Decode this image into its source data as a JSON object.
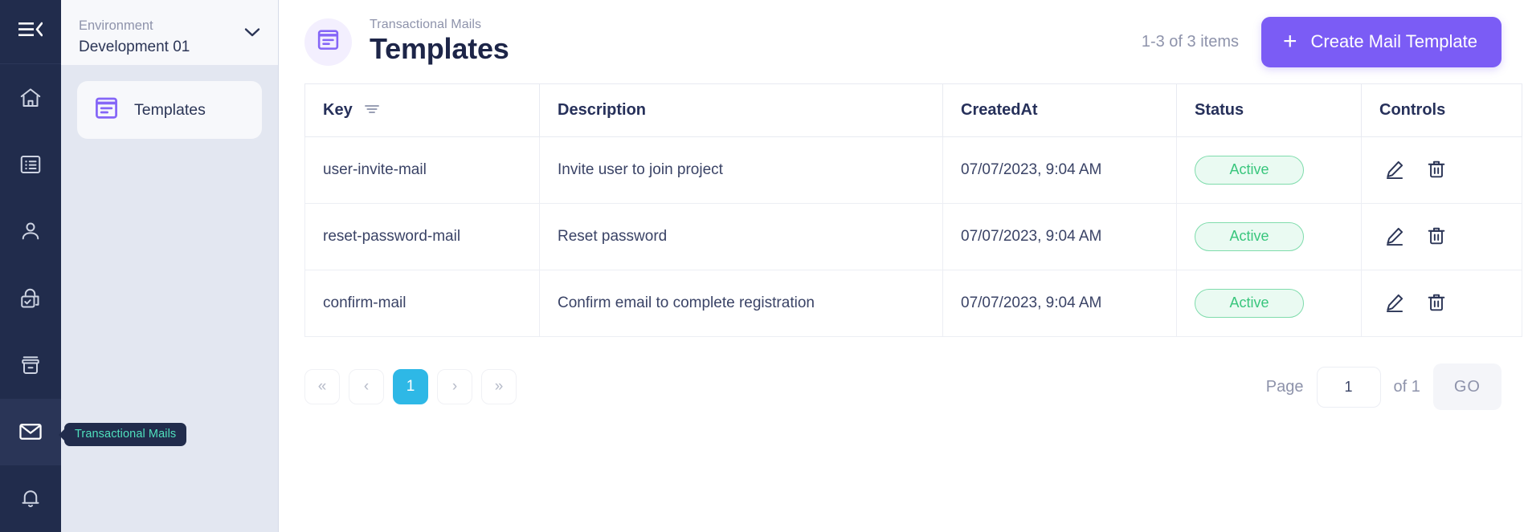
{
  "rail": {
    "collapse_icon": "hamburger-collapse-icon",
    "items": [
      {
        "name": "home-icon",
        "label": "Home"
      },
      {
        "name": "list-icon",
        "label": "Content"
      },
      {
        "name": "person-icon",
        "label": "Users"
      },
      {
        "name": "lock-check-icon",
        "label": "Security"
      },
      {
        "name": "archive-icon",
        "label": "Archive"
      },
      {
        "name": "mail-icon",
        "label": "Transactional Mails",
        "active": true
      },
      {
        "name": "bell-icon",
        "label": "Notifications"
      }
    ],
    "tooltip": "Transactional Mails"
  },
  "subnav": {
    "env_label": "Environment",
    "env_value": "Development 01",
    "items": [
      {
        "label": "Templates",
        "icon": "document-lines-icon",
        "active": true
      }
    ]
  },
  "header": {
    "breadcrumb": "Transactional Mails",
    "title": "Templates",
    "item_count": "1-3 of 3 items",
    "create_label": "Create Mail Template",
    "plus": "+"
  },
  "table": {
    "columns": [
      {
        "label": "Key",
        "filterable": true
      },
      {
        "label": "Description",
        "filterable": false
      },
      {
        "label": "CreatedAt",
        "filterable": false
      },
      {
        "label": "Status",
        "filterable": false
      },
      {
        "label": "Controls",
        "filterable": false
      }
    ],
    "rows": [
      {
        "key": "user-invite-mail",
        "description": "Invite user to join project",
        "created_at": "07/07/2023, 9:04 AM",
        "status": "Active"
      },
      {
        "key": "reset-password-mail",
        "description": "Reset password",
        "created_at": "07/07/2023, 9:04 AM",
        "status": "Active"
      },
      {
        "key": "confirm-mail",
        "description": "Confirm email to complete registration",
        "created_at": "07/07/2023, 9:04 AM",
        "status": "Active"
      }
    ]
  },
  "pagination": {
    "first": "«",
    "prev": "‹",
    "current_page": "1",
    "next": "›",
    "last": "»",
    "page_label": "Page",
    "page_value": "1",
    "of_label": "of 1",
    "go_label": "GO"
  },
  "colors": {
    "accent_purple": "#7b5cf5",
    "rail_navy": "#212c4c",
    "active_green": "#39c67d",
    "page_cyan": "#2eb8e6",
    "tooltip_text": "#4fe0bd"
  }
}
